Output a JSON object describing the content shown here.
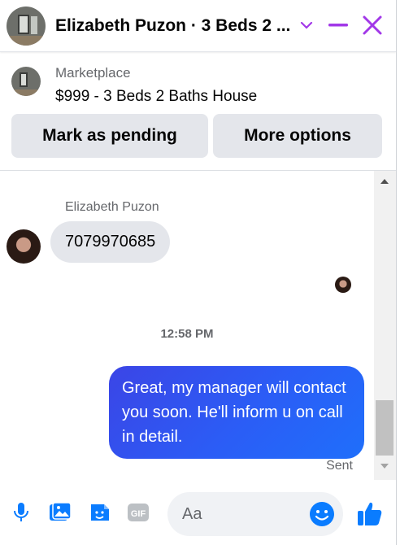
{
  "colors": {
    "accent": "#a238e8",
    "brand_blue": "#0a7cff",
    "bubble_gradient_start": "#3b45e6",
    "bubble_gradient_end": "#1f6ffb",
    "muted_text": "#65676b"
  },
  "header": {
    "title": "Elizabeth Puzon · 3 Beds 2 ...",
    "icons": {
      "chevron": "chevron-down-icon",
      "minimize": "minimize-icon",
      "close": "close-icon"
    }
  },
  "marketplace": {
    "label": "Marketplace",
    "listing": "$999 - 3 Beds 2 Baths House",
    "mark_pending_label": "Mark as pending",
    "more_options_label": "More options"
  },
  "conversation": {
    "sender_name": "Elizabeth Puzon",
    "incoming_message": "7079970685",
    "timestamp": "12:58 PM",
    "outgoing_message": "Great, my manager will contact you soon. He'll inform u on call in detail.",
    "status": "Sent"
  },
  "composer": {
    "placeholder": "Aa",
    "icons": [
      "microphone-icon",
      "photo-icon",
      "sticker-icon",
      "gif-icon",
      "emoji-icon",
      "thumbs-up-icon"
    ],
    "gif_label": "GIF"
  }
}
